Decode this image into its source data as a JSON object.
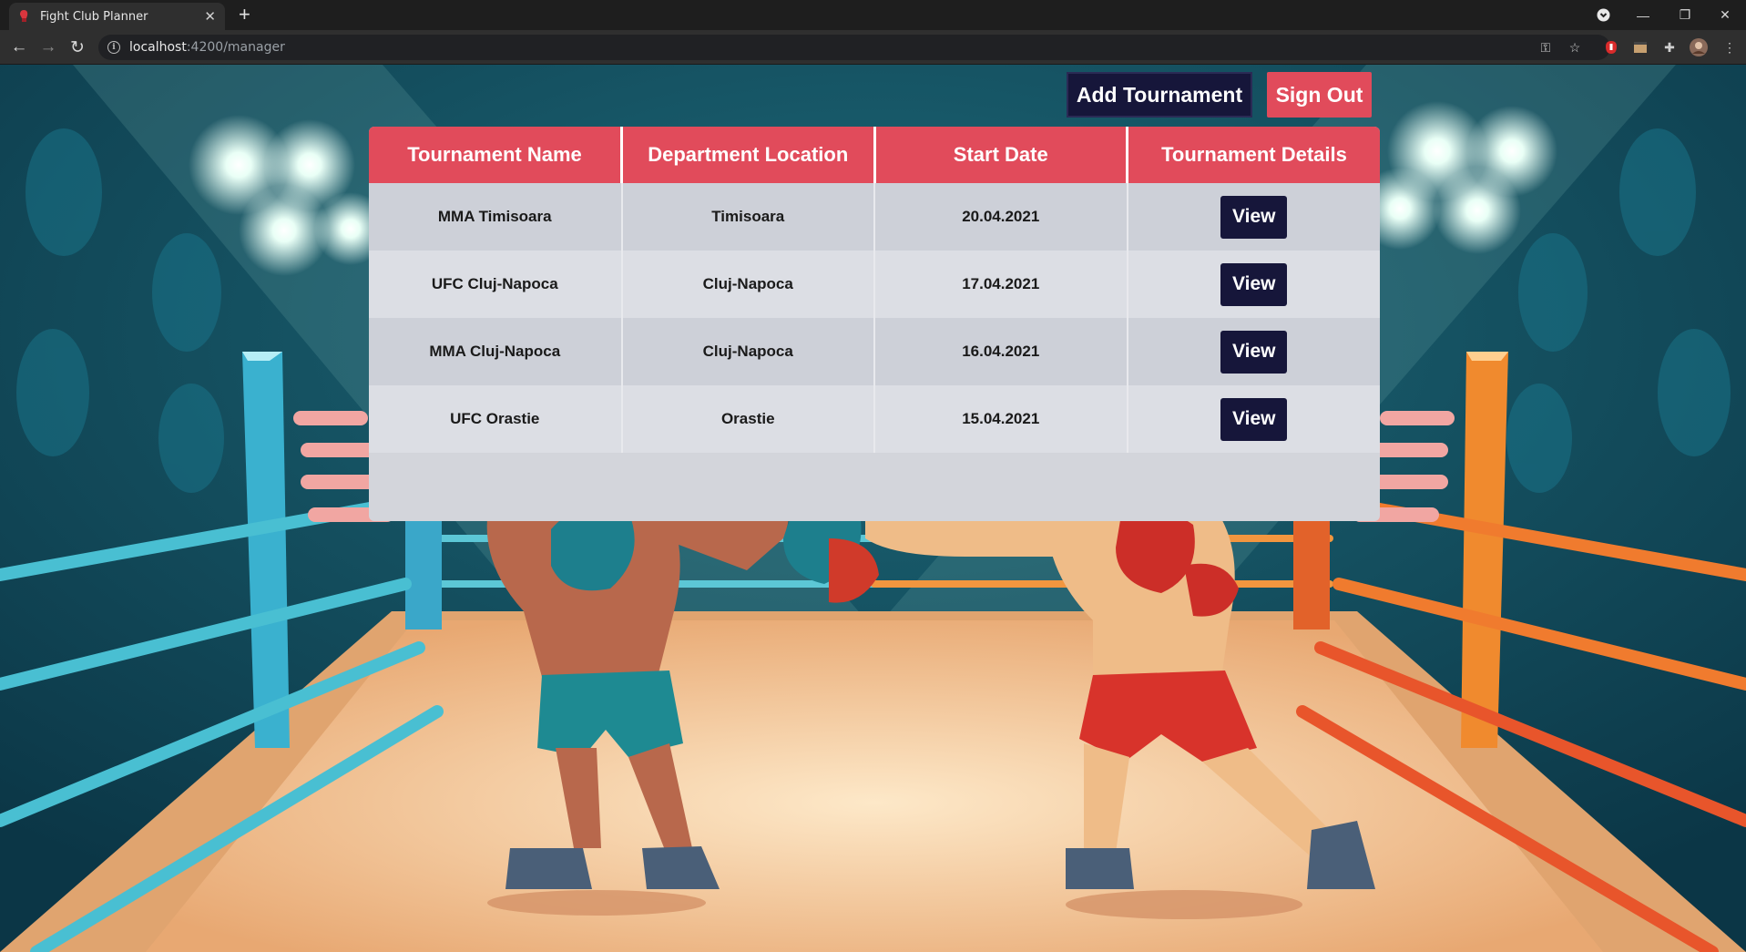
{
  "browser": {
    "tab_title": "Fight Club Planner",
    "url_host": "localhost",
    "url_path": ":4200/manager"
  },
  "header": {
    "add_tournament_label": "Add Tournament",
    "sign_out_label": "Sign Out"
  },
  "table": {
    "columns": [
      "Tournament Name",
      "Department Location",
      "Start Date",
      "Tournament Details"
    ],
    "rows": [
      {
        "name": "MMA Timisoara",
        "location": "Timisoara",
        "start_date": "20.04.2021",
        "action": "View"
      },
      {
        "name": "UFC Cluj-Napoca",
        "location": "Cluj-Napoca",
        "start_date": "17.04.2021",
        "action": "View"
      },
      {
        "name": "MMA Cluj-Napoca",
        "location": "Cluj-Napoca",
        "start_date": "16.04.2021",
        "action": "View"
      },
      {
        "name": "UFC Orastie",
        "location": "Orastie",
        "start_date": "15.04.2021",
        "action": "View"
      }
    ]
  },
  "colors": {
    "accent_red": "#e14b5b",
    "navy": "#16163a",
    "ring_floor": "#f3c99c",
    "arena_bg": "#0f4a5c"
  }
}
